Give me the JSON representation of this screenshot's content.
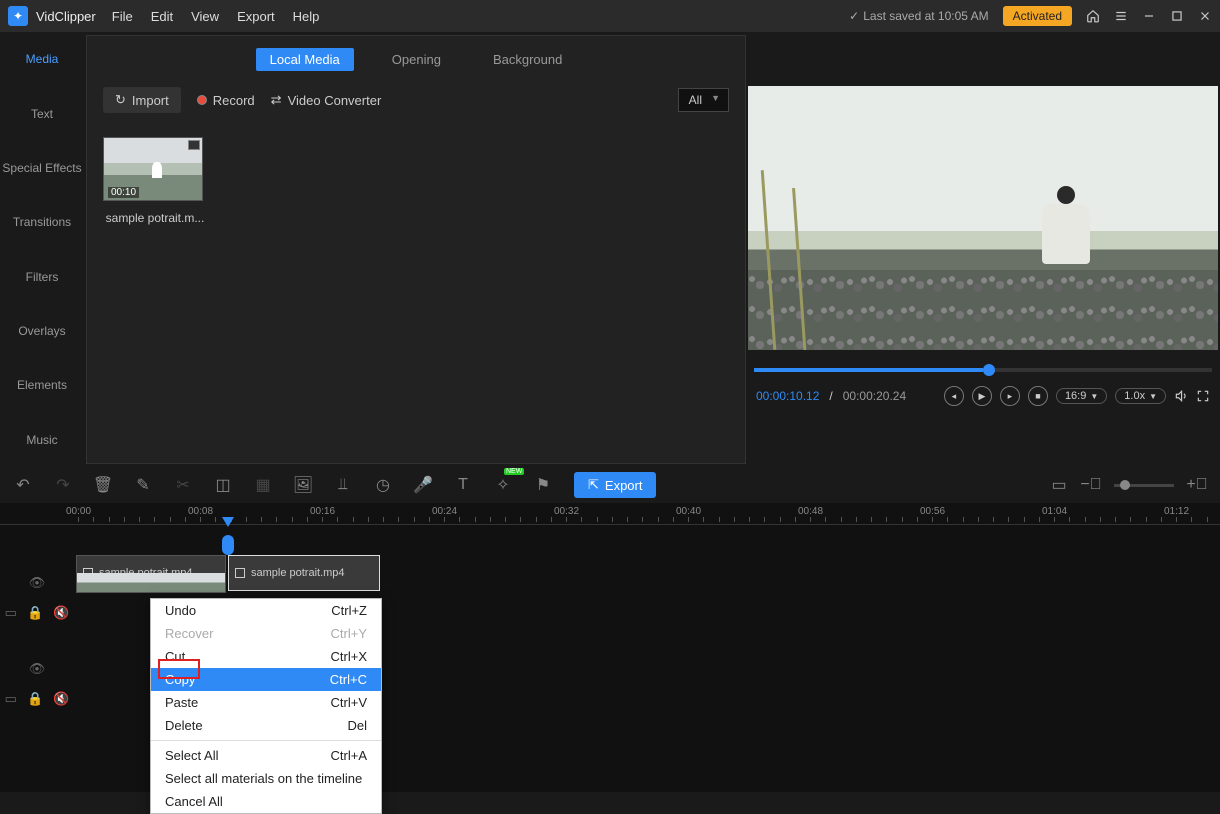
{
  "app": {
    "name": "VidClipper"
  },
  "menu": [
    "File",
    "Edit",
    "View",
    "Export",
    "Help"
  ],
  "titlebar": {
    "last_saved": "Last saved at 10:05 AM",
    "activated": "Activated"
  },
  "sidebar": [
    "Media",
    "Text",
    "Special Effects",
    "Transitions",
    "Filters",
    "Overlays",
    "Elements",
    "Music"
  ],
  "media": {
    "tabs": [
      "Local Media",
      "Opening",
      "Background"
    ],
    "import": "Import",
    "record": "Record",
    "video_converter": "Video Converter",
    "filter": "All",
    "items": [
      {
        "name": "sample potrait.m...",
        "duration": "00:10"
      }
    ]
  },
  "preview": {
    "current": "00:00:10.12",
    "duration": "00:00:20.24",
    "aspect": "16:9",
    "speed": "1.0x"
  },
  "toolbar": {
    "export": "Export"
  },
  "timeline": {
    "ticks": [
      "00:00",
      "00:08",
      "00:16",
      "00:24",
      "00:32",
      "00:40",
      "00:48",
      "00:56",
      "01:04",
      "01:12"
    ],
    "clips": [
      {
        "name": "sample potrait.mp4"
      },
      {
        "name": "sample potrait.mp4"
      }
    ]
  },
  "context_menu": [
    {
      "label": "Undo",
      "shortcut": "Ctrl+Z"
    },
    {
      "label": "Recover",
      "shortcut": "Ctrl+Y",
      "disabled": true
    },
    {
      "label": "Cut",
      "shortcut": "Ctrl+X"
    },
    {
      "label": "Copy",
      "shortcut": "Ctrl+C",
      "highlight": true
    },
    {
      "label": "Paste",
      "shortcut": "Ctrl+V"
    },
    {
      "label": "Delete",
      "shortcut": "Del"
    },
    {
      "sep": true
    },
    {
      "label": "Select All",
      "shortcut": "Ctrl+A"
    },
    {
      "label": "Select all materials on the timeline"
    },
    {
      "label": "Cancel All"
    }
  ]
}
